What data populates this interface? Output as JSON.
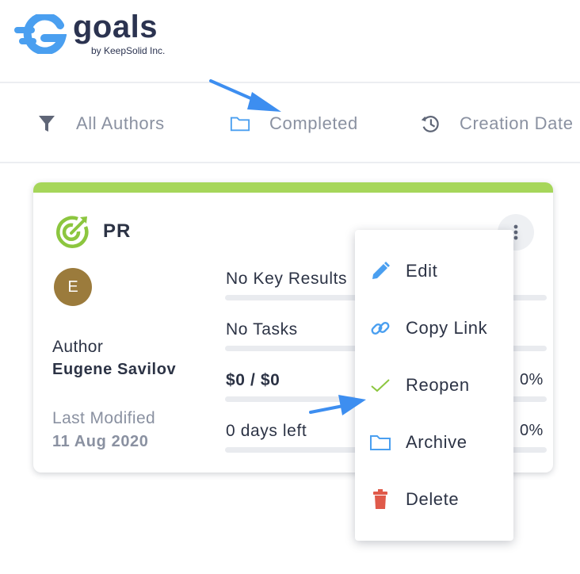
{
  "logo": {
    "word": "goals",
    "byline": "by KeepSolid Inc."
  },
  "filters": [
    {
      "label": "All Authors",
      "icon": "filter-icon"
    },
    {
      "label": "Completed",
      "icon": "folder-icon"
    },
    {
      "label": "Creation Date",
      "icon": "history-icon"
    }
  ],
  "card": {
    "title": "PR",
    "icon": "goal-target-icon",
    "stripe_color": "#a6d65a",
    "avatar_initial": "E",
    "author_label": "Author",
    "author_name": "Eugene Savilov",
    "modified_label": "Last Modified",
    "modified_date": "11 Aug 2020",
    "metrics": [
      {
        "text": "No Key Results",
        "percent": ""
      },
      {
        "text": "No Tasks",
        "percent": ""
      },
      {
        "text": "$0 / $0",
        "percent": "0%"
      },
      {
        "text": "0 days left",
        "percent": "0%"
      }
    ]
  },
  "menu": {
    "items": [
      {
        "label": "Edit",
        "icon": "pencil-icon"
      },
      {
        "label": "Copy Link",
        "icon": "link-icon"
      },
      {
        "label": "Reopen",
        "icon": "checkmark-icon"
      },
      {
        "label": "Archive",
        "icon": "folder-icon"
      },
      {
        "label": "Delete",
        "icon": "trash-icon"
      }
    ]
  },
  "colors": {
    "accent": "#4a9ff0",
    "brand_dark": "#2b3350",
    "muted": "#8a91a1",
    "delete": "#e05a4a",
    "success": "#8cc63f"
  }
}
